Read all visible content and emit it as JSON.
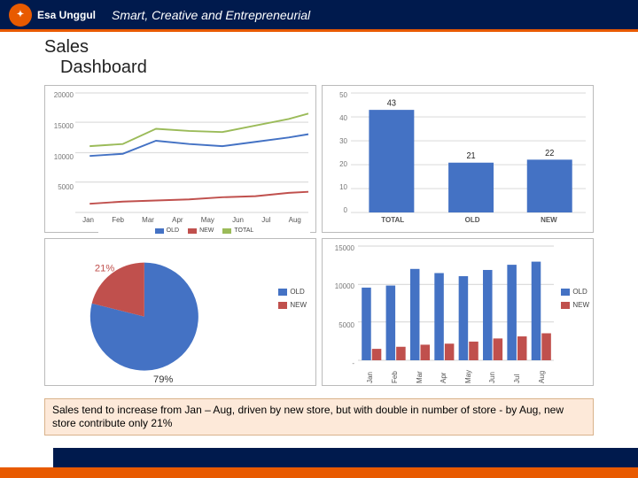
{
  "header": {
    "logo_text": "Esa Unggul",
    "slogan": "Smart, Creative and Entrepreneurial"
  },
  "title": {
    "line1": "Sales",
    "line2": "Dashboard"
  },
  "note": "Sales tend to increase from Jan – Aug,  driven by new store, but with double in number of store - by Aug,  new store contribute only 21%",
  "colors": {
    "old": "#4472c4",
    "new": "#c0504d",
    "total": "#9bbb59"
  },
  "chart_data": [
    {
      "type": "line",
      "title": "",
      "xlabel": "",
      "ylabel": "",
      "ylim": [
        0,
        20000
      ],
      "yticks": [
        5000,
        10000,
        15000,
        20000
      ],
      "categories": [
        "Jan",
        "Feb",
        "Mar",
        "Apr",
        "May",
        "Jun",
        "Jul",
        "Aug"
      ],
      "series": [
        {
          "name": "OLD",
          "values": [
            9500,
            9800,
            12000,
            11500,
            11000,
            11800,
            12500,
            13000
          ]
        },
        {
          "name": "NEW",
          "values": [
            1500,
            1800,
            2000,
            2200,
            2500,
            2800,
            3200,
            3500
          ]
        },
        {
          "name": "TOTAL",
          "values": [
            11000,
            11600,
            14000,
            13700,
            13500,
            14600,
            15700,
            16500
          ]
        }
      ]
    },
    {
      "type": "bar",
      "title": "",
      "xlabel": "",
      "ylabel": "",
      "ylim": [
        0,
        50
      ],
      "yticks": [
        0,
        10,
        20,
        30,
        40,
        50
      ],
      "categories": [
        "TOTAL",
        "OLD",
        "NEW"
      ],
      "values": [
        43,
        21,
        22
      ],
      "data_labels": [
        "43",
        "21",
        "22"
      ]
    },
    {
      "type": "pie",
      "title": "",
      "series": [
        {
          "name": "OLD",
          "value": 79,
          "label": "79%"
        },
        {
          "name": "NEW",
          "value": 21,
          "label": "21%"
        }
      ],
      "legend": [
        "OLD",
        "NEW"
      ]
    },
    {
      "type": "bar",
      "subtype": "grouped",
      "title": "",
      "xlabel": "",
      "ylabel": "",
      "ylim": [
        0,
        15000
      ],
      "yticks": [
        5000,
        10000,
        15000
      ],
      "yticks_label_dash": "-",
      "categories": [
        "Jan",
        "Feb",
        "Mar",
        "Apr",
        "May",
        "Jun",
        "Jul",
        "Aug"
      ],
      "series": [
        {
          "name": "OLD",
          "values": [
            9500,
            9800,
            12000,
            11500,
            11000,
            11800,
            12500,
            13000
          ]
        },
        {
          "name": "NEW",
          "values": [
            1500,
            1800,
            2000,
            2200,
            2500,
            2800,
            3200,
            3500
          ]
        }
      ],
      "legend": [
        "OLD",
        "NEW"
      ]
    }
  ]
}
